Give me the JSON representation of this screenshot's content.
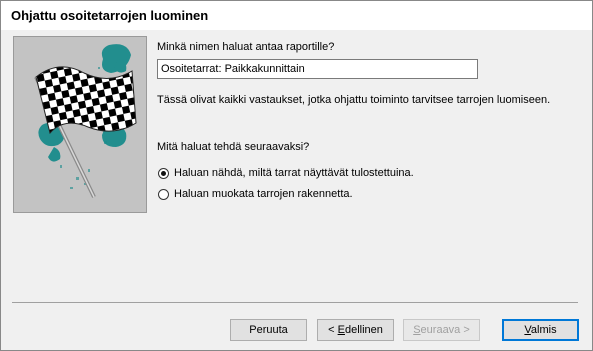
{
  "window": {
    "title": "Ohjattu osoitetarrojen luominen"
  },
  "form": {
    "name_prompt": "Minkä nimen haluat antaa raportille?",
    "name_value": "Osoitetarrat: Paikkakunnittain",
    "info_text": "Tässä olivat kaikki vastaukset, jotka ohjattu toiminto tarvitsee tarrojen luomiseen.",
    "next_question": "Mitä haluat tehdä seuraavaksi?",
    "options": [
      {
        "label": "Haluan nähdä, miltä tarrat näyttävät tulostettuina.",
        "selected": true
      },
      {
        "label": "Haluan muokata tarrojen rakennetta.",
        "selected": false
      }
    ]
  },
  "buttons": {
    "cancel": "Peruuta",
    "back_prefix": "< ",
    "back_accel": "E",
    "back_rest": "dellinen",
    "next_accel": "S",
    "next_rest": "euraava >",
    "finish_accel": "V",
    "finish_rest": "almis"
  },
  "icons": {
    "side_image": "checkered-flag-icon"
  },
  "colors": {
    "accent": "#0078d7",
    "flag_teal": "#1a8c8c"
  }
}
